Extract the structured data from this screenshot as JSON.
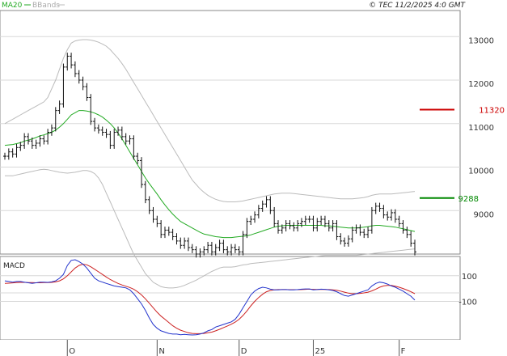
{
  "header": {
    "indicator_ma20": "MA20",
    "indicator_bbands": "BBands",
    "copyright": "© TEC 11/2/2025 4:0 GMT"
  },
  "macd_panel": {
    "label": "MACD"
  },
  "colors": {
    "ma20": "#22aa22",
    "bbands": "#bbbbbb",
    "candles": "#111111",
    "resistance": "#cc0000",
    "support": "#008800",
    "macd": "#2233cc",
    "signal": "#cc2222",
    "grid": "#d8d8d8"
  },
  "chart_data": [
    {
      "type": "line",
      "title": "",
      "series_labels": {
        "ma20": "MA20",
        "bbands": "BBands"
      },
      "y_ticks": [
        {
          "label": "9000",
          "value": 9000
        },
        {
          "label": "10000",
          "value": 10000
        },
        {
          "label": "11000",
          "value": 11000
        },
        {
          "label": "12000",
          "value": 12000
        },
        {
          "label": "13000",
          "value": 13000
        }
      ],
      "ylim": [
        8000,
        13600
      ],
      "x_ticks": [
        {
          "label": "O",
          "index": 16
        },
        {
          "label": "N",
          "index": 39
        },
        {
          "label": "D",
          "index": 60
        },
        {
          "label": "25",
          "index": 79
        },
        {
          "label": "F",
          "index": 101
        }
      ],
      "grid": true,
      "levels": [
        {
          "name": "resistance",
          "value": 11320,
          "label": "11320"
        },
        {
          "name": "support",
          "value": 9288,
          "label": "9288"
        }
      ],
      "price_closes": [
        10250,
        10350,
        10300,
        10450,
        10500,
        10700,
        10600,
        10500,
        10550,
        10650,
        10600,
        10800,
        10900,
        11300,
        11450,
        12300,
        12550,
        12350,
        12150,
        12000,
        11850,
        11600,
        11050,
        10900,
        10850,
        10800,
        10750,
        10500,
        10800,
        10850,
        10700,
        10600,
        10650,
        10250,
        10150,
        9600,
        9250,
        9000,
        8800,
        8700,
        8450,
        8550,
        8500,
        8400,
        8300,
        8200,
        8300,
        8150,
        8100,
        8000,
        8050,
        8100,
        8200,
        8050,
        8150,
        8250,
        8100,
        8050,
        8150,
        8100,
        8050,
        8450,
        8750,
        8800,
        8900,
        9050,
        9150,
        9250,
        9000,
        8700,
        8550,
        8600,
        8700,
        8650,
        8600,
        8700,
        8750,
        8800,
        8800,
        8600,
        8750,
        8800,
        8700,
        8600,
        8700,
        8400,
        8300,
        8250,
        8350,
        8550,
        8600,
        8500,
        8450,
        8550,
        9000,
        9100,
        9050,
        8900,
        8850,
        8950,
        8800,
        8700,
        8550,
        8450,
        8250,
        8050
      ],
      "ma20": [
        10500,
        10510,
        10520,
        10540,
        10560,
        10600,
        10620,
        10650,
        10680,
        10720,
        10740,
        10770,
        10800,
        10850,
        10920,
        11000,
        11100,
        11200,
        11250,
        11300,
        11300,
        11290,
        11270,
        11240,
        11200,
        11150,
        11080,
        11000,
        10900,
        10780,
        10650,
        10500,
        10350,
        10200,
        10050,
        9900,
        9750,
        9620,
        9500,
        9380,
        9250,
        9130,
        9020,
        8920,
        8830,
        8750,
        8700,
        8650,
        8600,
        8550,
        8500,
        8460,
        8440,
        8420,
        8400,
        8390,
        8380,
        8380,
        8380,
        8390,
        8400,
        8410,
        8420,
        8440,
        8470,
        8500,
        8530,
        8560,
        8590,
        8620,
        8640,
        8650,
        8660,
        8660,
        8660,
        8660,
        8660,
        8660,
        8660,
        8660,
        8660,
        8660,
        8650,
        8650,
        8640,
        8630,
        8620,
        8610,
        8600,
        8600,
        8600,
        8610,
        8620,
        8630,
        8650,
        8660,
        8660,
        8650,
        8640,
        8630,
        8620,
        8600,
        8580,
        8560,
        8540,
        8520
      ],
      "bb_upper": [
        11000,
        11050,
        11100,
        11150,
        11200,
        11250,
        11300,
        11350,
        11400,
        11450,
        11500,
        11600,
        11800,
        12000,
        12250,
        12500,
        12700,
        12850,
        12900,
        12920,
        12930,
        12930,
        12920,
        12900,
        12870,
        12830,
        12780,
        12700,
        12600,
        12500,
        12380,
        12250,
        12100,
        11950,
        11800,
        11650,
        11500,
        11350,
        11200,
        11050,
        10900,
        10750,
        10600,
        10450,
        10300,
        10150,
        10000,
        9850,
        9700,
        9600,
        9500,
        9420,
        9350,
        9300,
        9260,
        9230,
        9210,
        9200,
        9200,
        9200,
        9210,
        9220,
        9240,
        9260,
        9280,
        9300,
        9320,
        9340,
        9360,
        9380,
        9390,
        9400,
        9400,
        9400,
        9390,
        9380,
        9370,
        9360,
        9350,
        9340,
        9330,
        9320,
        9310,
        9300,
        9290,
        9280,
        9270,
        9270,
        9270,
        9270,
        9280,
        9290,
        9300,
        9320,
        9350,
        9370,
        9380,
        9380,
        9380,
        9380,
        9390,
        9400,
        9410,
        9420,
        9430,
        9440
      ],
      "bb_lower": [
        9800,
        9800,
        9800,
        9820,
        9840,
        9860,
        9880,
        9900,
        9920,
        9940,
        9950,
        9940,
        9920,
        9900,
        9880,
        9870,
        9860,
        9870,
        9880,
        9900,
        9920,
        9920,
        9900,
        9850,
        9750,
        9600,
        9400,
        9200,
        9000,
        8800,
        8600,
        8400,
        8200,
        8000,
        7850,
        7700,
        7550,
        7450,
        7350,
        7300,
        7250,
        7230,
        7220,
        7220,
        7230,
        7250,
        7280,
        7320,
        7360,
        7400,
        7450,
        7500,
        7550,
        7600,
        7640,
        7680,
        7700,
        7700,
        7700,
        7710,
        7730,
        7750,
        7760,
        7780,
        7790,
        7800,
        7810,
        7820,
        7830,
        7840,
        7850,
        7860,
        7870,
        7880,
        7890,
        7900,
        7910,
        7920,
        7930,
        7940,
        7950,
        7960,
        7970,
        7970,
        7970,
        7970,
        7970,
        7970,
        7970,
        7970,
        7970,
        7980,
        7990,
        8000,
        8010,
        8020,
        8030,
        8040,
        8050,
        8060,
        8070,
        8080,
        8090,
        8100,
        8110,
        8120
      ]
    },
    {
      "type": "line",
      "title": "",
      "series_labels": {
        "macd": "",
        "signal": ""
      },
      "y_ticks": [
        {
          "label": "100",
          "value": 100
        },
        {
          "label": "-100",
          "value": -100
        }
      ],
      "ylim": [
        -400,
        250
      ],
      "macd": [
        60,
        55,
        50,
        55,
        55,
        50,
        45,
        40,
        45,
        50,
        50,
        48,
        52,
        60,
        80,
        110,
        180,
        220,
        225,
        210,
        190,
        160,
        120,
        80,
        60,
        50,
        40,
        30,
        20,
        15,
        10,
        5,
        -10,
        -40,
        -80,
        -120,
        -170,
        -230,
        -280,
        -310,
        -330,
        -340,
        -350,
        -355,
        -355,
        -360,
        -358,
        -360,
        -362,
        -360,
        -355,
        -345,
        -330,
        -320,
        -300,
        -290,
        -280,
        -270,
        -260,
        -240,
        -200,
        -150,
        -100,
        -50,
        -20,
        0,
        10,
        5,
        -5,
        -10,
        -10,
        -8,
        -8,
        -10,
        -10,
        -8,
        -5,
        -3,
        -3,
        -10,
        -8,
        -5,
        -6,
        -10,
        -15,
        -25,
        -40,
        -55,
        -60,
        -50,
        -40,
        -30,
        -20,
        -10,
        20,
        40,
        50,
        45,
        35,
        20,
        10,
        -5,
        -20,
        -40,
        -60,
        -90
      ],
      "signal": [
        40,
        42,
        44,
        46,
        48,
        48,
        47,
        46,
        45,
        45,
        46,
        46,
        48,
        52,
        60,
        75,
        100,
        130,
        160,
        180,
        190,
        185,
        170,
        150,
        130,
        110,
        90,
        70,
        55,
        40,
        28,
        18,
        8,
        -5,
        -25,
        -50,
        -80,
        -115,
        -150,
        -185,
        -215,
        -240,
        -265,
        -290,
        -310,
        -325,
        -335,
        -345,
        -350,
        -352,
        -352,
        -350,
        -345,
        -340,
        -330,
        -318,
        -305,
        -292,
        -278,
        -262,
        -240,
        -210,
        -175,
        -135,
        -100,
        -70,
        -45,
        -25,
        -15,
        -10,
        -8,
        -8,
        -8,
        -9,
        -9,
        -9,
        -8,
        -6,
        -5,
        -6,
        -7,
        -7,
        -7,
        -8,
        -10,
        -14,
        -20,
        -28,
        -36,
        -40,
        -40,
        -38,
        -34,
        -28,
        -18,
        -5,
        10,
        20,
        25,
        24,
        18,
        10,
        0,
        -12,
        -25,
        -40
      ]
    }
  ]
}
